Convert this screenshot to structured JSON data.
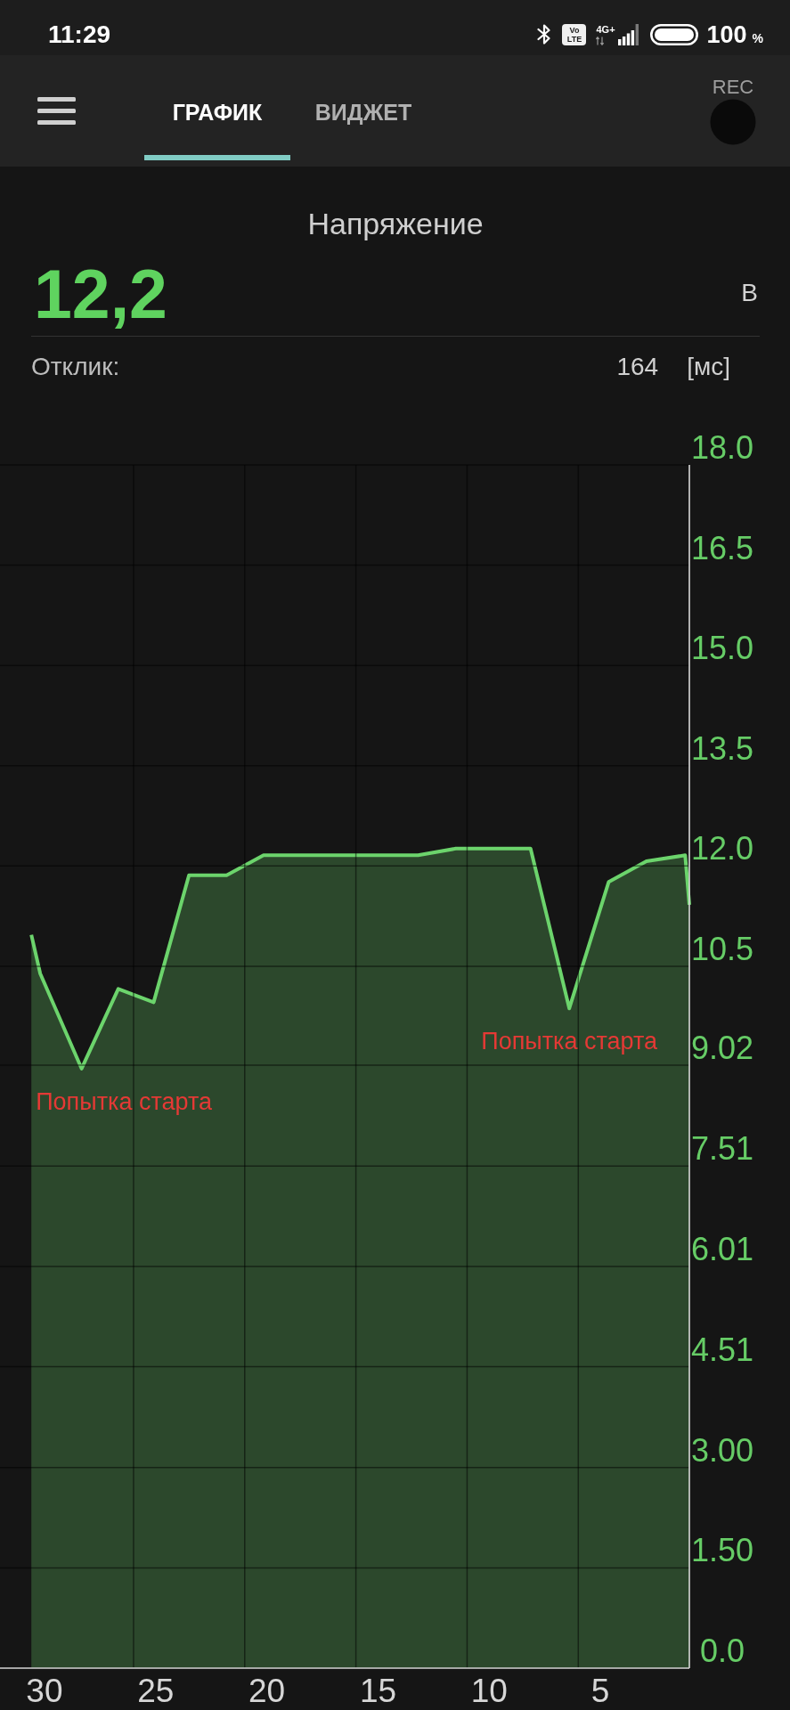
{
  "status_bar": {
    "time": "11:29",
    "volte": "Vo LTE",
    "network": "4G+",
    "battery": "100",
    "battery_unit": "%"
  },
  "app_bar": {
    "tabs": [
      {
        "label": "ГРАФИК",
        "selected": true
      },
      {
        "label": "ВИДЖЕТ",
        "selected": false
      }
    ],
    "record_button": {
      "label": "REC"
    }
  },
  "measurement": {
    "title": "Напряжение",
    "value": "12,2",
    "unit": "В",
    "response_label": "Отклик:",
    "response_value": "164",
    "response_unit": "[мс]"
  },
  "chart": {
    "chart_data": {
      "type": "area",
      "x": [
        30.59,
        30.19,
        28.33,
        26.68,
        25.09,
        23.5,
        21.81,
        20.15,
        13.2,
        11.5,
        8.14,
        6.4,
        4.63,
        2.93,
        1.19,
        1.0
      ],
      "series": [
        {
          "color": "#6cd46c",
          "values": [
            10.97,
            10.39,
            8.97,
            10.16,
            9.96,
            11.86,
            11.86,
            12.16,
            12.16,
            12.26,
            12.26,
            9.87,
            11.76,
            12.07,
            12.16,
            11.42
          ]
        }
      ],
      "xlim": [
        32,
        1
      ],
      "ylim": [
        0,
        18
      ],
      "xticks": [
        30,
        25,
        20,
        15,
        10,
        5
      ],
      "yticks": [
        {
          "value": 18,
          "label": "18.0"
        },
        16.5,
        {
          "value": 15,
          "label": "15.0"
        },
        13.5,
        {
          "value": 12,
          "label": "12.0"
        },
        10.5,
        9.02,
        7.51,
        6.01,
        4.51,
        {
          "value": 3,
          "label": "3.00"
        },
        {
          "value": 1.5,
          "label": "1.50"
        },
        {
          "value": 0,
          "label": "0.0"
        }
      ],
      "grid": true,
      "annotations": [
        {
          "text": "Попытка старта",
          "x": 28.33,
          "y": 8.97
        },
        {
          "text": "Попытка старта",
          "x": 6.4,
          "y": 9.87
        }
      ]
    }
  }
}
